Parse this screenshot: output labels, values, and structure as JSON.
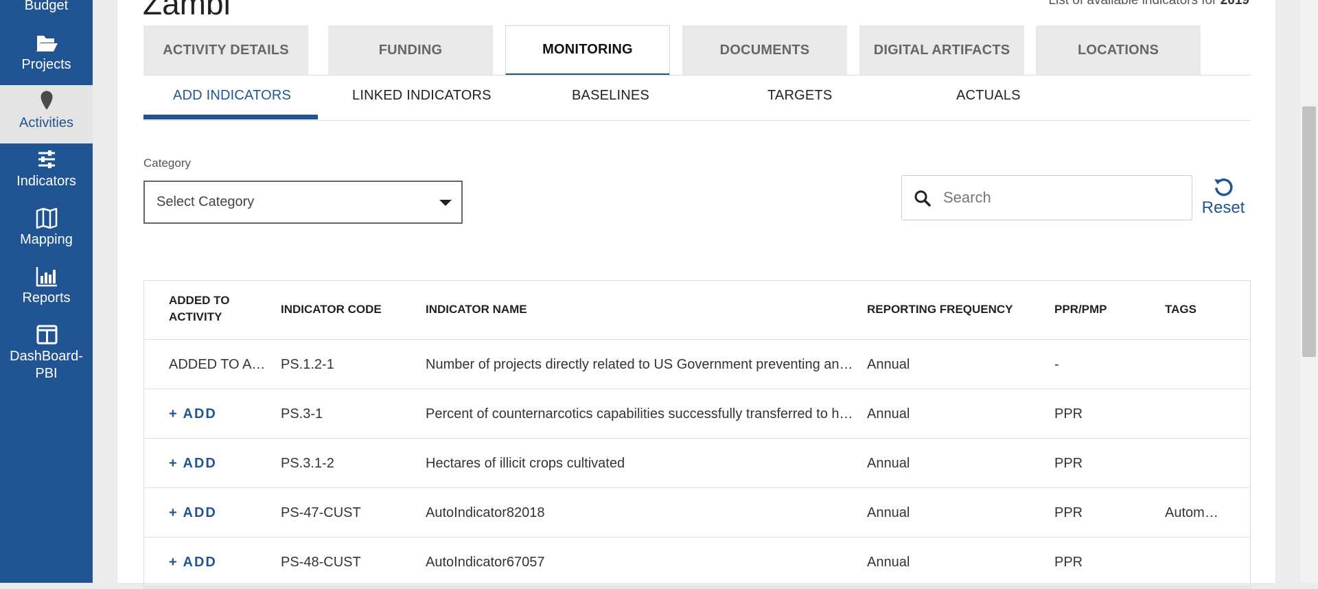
{
  "sidebar": {
    "items": [
      {
        "label": "Budget",
        "icon": "budget-icon"
      },
      {
        "label": "Projects",
        "icon": "folder-open-icon"
      },
      {
        "label": "Activities",
        "icon": "map-pin-icon",
        "active": true
      },
      {
        "label": "Indicators",
        "icon": "sliders-icon"
      },
      {
        "label": "Mapping",
        "icon": "map-icon"
      },
      {
        "label": "Reports",
        "icon": "bar-chart-icon"
      },
      {
        "label": "DashBoard-PBI",
        "icon": "columns-icon"
      }
    ]
  },
  "header": {
    "title": "Zambi",
    "available_prefix": "List of available indicators for",
    "available_year": "2019"
  },
  "tabs": [
    {
      "label": "ACTIVITY DETAILS"
    },
    {
      "label": "FUNDING"
    },
    {
      "label": "MONITORING",
      "active": true
    },
    {
      "label": "DOCUMENTS"
    },
    {
      "label": "DIGITAL ARTIFACTS"
    },
    {
      "label": "LOCATIONS"
    }
  ],
  "subtabs": [
    {
      "label": "ADD INDICATORS",
      "active": true
    },
    {
      "label": "LINKED INDICATORS"
    },
    {
      "label": "BASELINES"
    },
    {
      "label": "TARGETS"
    },
    {
      "label": "ACTUALS"
    }
  ],
  "filter": {
    "category_label": "Category",
    "category_value": "Select Category",
    "search_placeholder": "Search",
    "reset_label": "Reset"
  },
  "table": {
    "headers": {
      "added_line1": "ADDED TO",
      "added_line2": "ACTIVITY",
      "code": "INDICATOR CODE",
      "name": "INDICATOR NAME",
      "frequency": "REPORTING FREQUENCY",
      "ppr": "PPR/PMP",
      "tags": "TAGS"
    },
    "rows": [
      {
        "added": "ADDED TO ACTIVITY",
        "code": "PS.1.2-1",
        "name": "Number of projects directly related to US Government preventing and countering violent extremism",
        "frequency": "Annual",
        "ppr": "-",
        "tags": ""
      },
      {
        "added": "+ ADD",
        "code": "PS.3-1",
        "name": "Percent of counternarcotics capabilities successfully transferred to host nation",
        "frequency": "Annual",
        "ppr": "PPR",
        "tags": ""
      },
      {
        "added": "+ ADD",
        "code": "PS.3.1-2",
        "name": "Hectares of illicit crops cultivated",
        "frequency": "Annual",
        "ppr": "PPR",
        "tags": ""
      },
      {
        "added": "+ ADD",
        "code": "PS-47-CUST",
        "name": "AutoIndicator82018",
        "frequency": "Annual",
        "ppr": "PPR",
        "tags": "Automation"
      },
      {
        "added": "+ ADD",
        "code": "PS-48-CUST",
        "name": "AutoIndicator67057",
        "frequency": "Annual",
        "ppr": "PPR",
        "tags": ""
      }
    ]
  },
  "colors": {
    "sidebar": "#205493",
    "accent": "#205493",
    "tab_bg": "#e8e9ea"
  }
}
